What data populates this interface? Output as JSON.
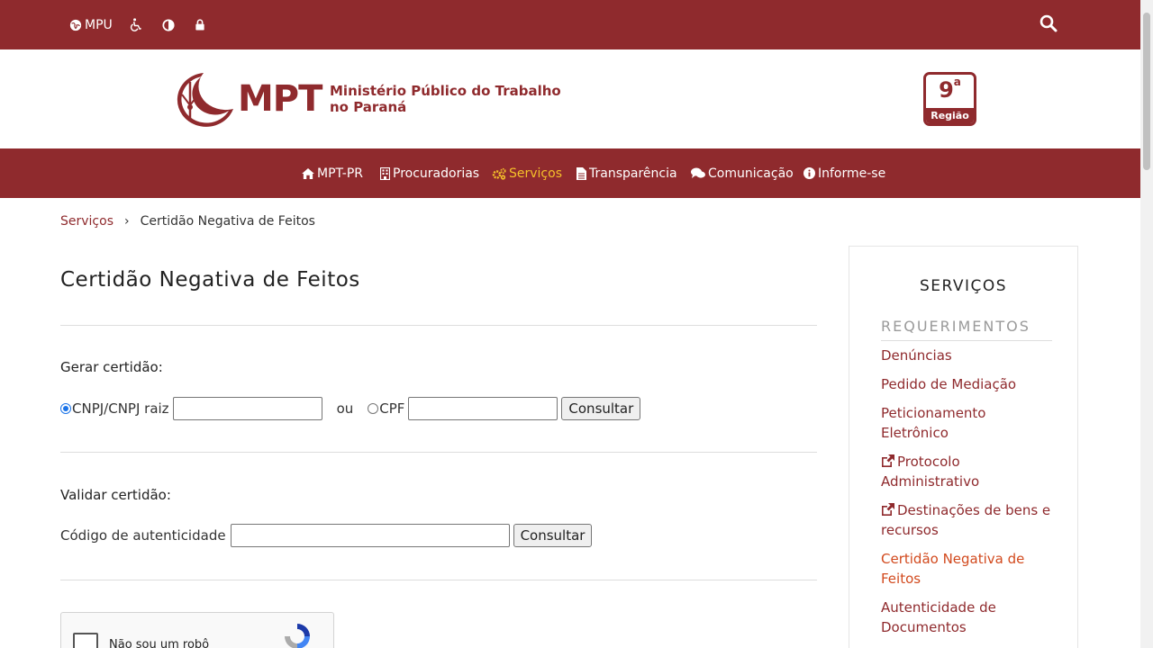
{
  "topbar": {
    "mpu_label": "MPU"
  },
  "header": {
    "logo_abbr": "MPT",
    "logo_name_line1": "Ministério Público do Trabalho",
    "logo_name_line2": "no Paraná",
    "region_number": "9",
    "region_super": "a",
    "region_label": "Região"
  },
  "nav": {
    "items": [
      {
        "label": "MPT-PR",
        "icon": "home-icon"
      },
      {
        "label": "Procuradorias",
        "icon": "building-icon"
      },
      {
        "label": "Serviços",
        "icon": "cogs-icon"
      },
      {
        "label": "Transparência",
        "icon": "file-icon"
      },
      {
        "label": "Comunicação",
        "icon": "comments-icon"
      },
      {
        "label": "Informe-se",
        "icon": "info-icon"
      }
    ],
    "active_color": "#f5c02a"
  },
  "breadcrumb": {
    "parent": "Serviços",
    "separator": "›",
    "current": "Certidão Negativa de Feitos"
  },
  "main": {
    "title": "Certidão Negativa de Feitos",
    "gerar_label": "Gerar certidão:",
    "cnpj_label": "CNPJ/CNPJ raiz",
    "ou_label": "ou",
    "cpf_label": "CPF",
    "consultar_label": "Consultar",
    "validar_label": "Validar certidão:",
    "codigo_label": "Código de autenticidade",
    "consultar2_label": "Consultar",
    "recaptcha_label": "Não sou um robô"
  },
  "sidebar": {
    "title": "SERVIÇOS",
    "section": "REQUERIMENTOS",
    "links": [
      {
        "label": "Denúncias"
      },
      {
        "label": "Pedido de Mediação"
      },
      {
        "label": "Peticionamento Eletrônico"
      },
      {
        "label": "Protocolo Administrativo"
      },
      {
        "label": "Destinações de bens e recursos"
      },
      {
        "label": "Certidão Negativa de Feitos"
      },
      {
        "label": "Autenticidade de Documentos"
      }
    ]
  },
  "colors": {
    "brand": "#8f2a2d",
    "accent_active_link": "#d24a1e"
  }
}
